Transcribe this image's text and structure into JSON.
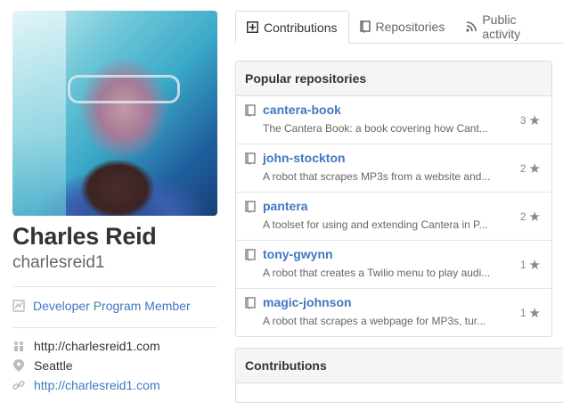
{
  "profile": {
    "full_name": "Charles Reid",
    "username": "charlesreid1",
    "badge_label": "Developer Program Member",
    "organization": "http://charlesreid1.com",
    "location": "Seattle",
    "website": "http://charlesreid1.com"
  },
  "tabs": [
    {
      "label": "Contributions",
      "icon": "contributions-icon",
      "active": true
    },
    {
      "label": "Repositories",
      "icon": "repo-icon",
      "active": false
    },
    {
      "label": "Public activity",
      "icon": "rss-icon",
      "active": false
    }
  ],
  "popular": {
    "title": "Popular repositories",
    "repos": [
      {
        "name": "cantera-book",
        "description": "The Cantera Book: a book covering how Cant...",
        "stars": "3"
      },
      {
        "name": "john-stockton",
        "description": "A robot that scrapes MP3s from a website and...",
        "stars": "2"
      },
      {
        "name": "pantera",
        "description": "A toolset for using and extending Cantera in P...",
        "stars": "2"
      },
      {
        "name": "tony-gwynn",
        "description": "A robot that creates a Twilio menu to play audi...",
        "stars": "1"
      },
      {
        "name": "magic-johnson",
        "description": "A robot that scrapes a webpage for MP3s, tur...",
        "stars": "1"
      }
    ]
  },
  "contributions": {
    "title": "Contributions"
  },
  "colors": {
    "link": "#4078c0",
    "muted": "#666666",
    "border": "#dddddd"
  }
}
